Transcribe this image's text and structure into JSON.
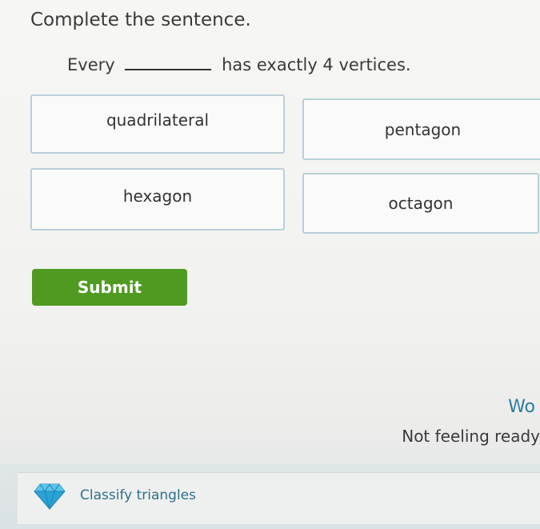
{
  "question": {
    "prompt": "Complete the sentence.",
    "sentence_start": "Every",
    "sentence_end": "has exactly 4 vertices."
  },
  "options": [
    "quadrilateral",
    "pentagon",
    "hexagon",
    "octagon"
  ],
  "submit_label": "Submit",
  "sidebar": {
    "heading_partial": "Wo",
    "not_ready_text": "Not feeling ready",
    "skill_link": "Classify triangles"
  },
  "colors": {
    "submit_green": "#4f9b21",
    "tile_border": "#b8d0d8",
    "link_blue": "#2f6f8c"
  },
  "icons": {
    "skill_icon": "diamond-icon"
  }
}
